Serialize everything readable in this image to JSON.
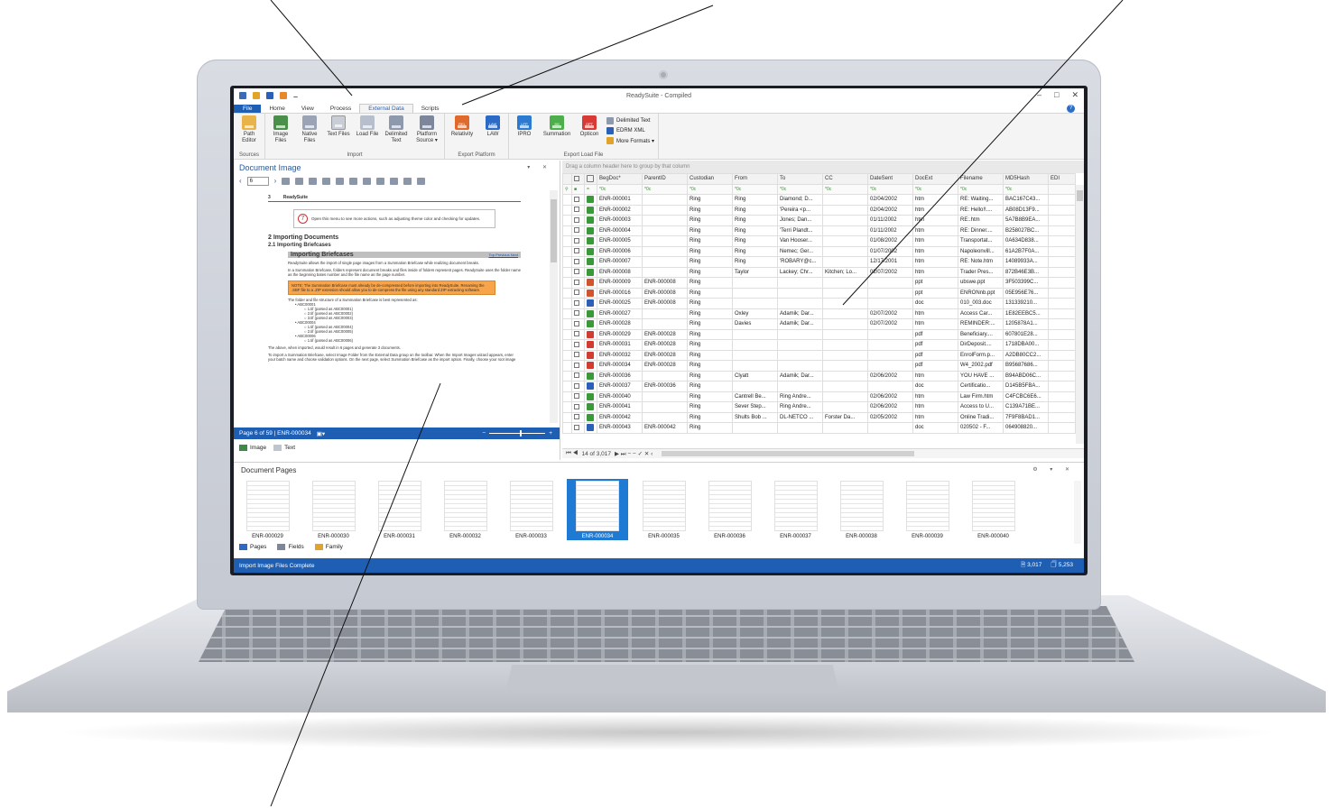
{
  "window": {
    "title": "ReadySuite - Compiled",
    "controls": [
      "–",
      "□",
      "✕"
    ]
  },
  "ribbon": {
    "tabs": [
      "File",
      "Home",
      "View",
      "Process",
      "External Data",
      "Scripts"
    ],
    "active_tab": "External Data",
    "help_glyph": "?",
    "groups": {
      "sources": {
        "label": "Sources",
        "buttons": [
          "Path Editor"
        ]
      },
      "import": {
        "label": "Import",
        "buttons": [
          "Image Files",
          "Native Files",
          "Text Files",
          "Load File",
          "Delimited Text",
          "Platform Source ▾"
        ]
      },
      "export_platform": {
        "label": "Export Platform",
        "buttons": [
          "Relativity",
          "LAW"
        ]
      },
      "export_load_file": {
        "label": "Export Load File",
        "buttons": [
          "IPRO",
          "Summation",
          "Opticon"
        ],
        "small": [
          "Delimited Text",
          "EDRM XML",
          "More Formats ▾"
        ]
      }
    },
    "icon_tags": [
      "REL",
      "LAW",
      "LFP",
      "DII",
      "OPT"
    ]
  },
  "doc_pane": {
    "title": "Document Image",
    "page_input": "6",
    "status_text": "Page 6 of 59  |  ENR-000034",
    "zoom_minus": "−",
    "zoom_plus": "+",
    "tabs": [
      "Image",
      "Text"
    ],
    "content": {
      "header_num": "3",
      "header_title": "ReadySuite",
      "note_num": "7",
      "note_text": "Open this menu to see more actions, such as adjusting theme color and checking for updates.",
      "section": "2     Importing Documents",
      "subsection": "2.1   Importing Briefcases",
      "banner": "Importing Briefcases",
      "banner_nav": "Top  Previous  Next",
      "p1": "ReadySuite allows the import of single page images from a Summation Briefcase while realizing document breaks.",
      "p2": "In a Summation Briefcase, folders represent document breaks and files inside of folders represent pages. ReadySuite uses the folder name as the beginning bates number and the file name as the page number.",
      "note_orange": "NOTE: The Summation Briefcase must already be de-compressed before importing into ReadySuite. Renaming the .SBF file to a .ZIP extension should allow you to de-compress the file using any standard ZIP extracting software.",
      "p3": "The folder and file structure of a Summation Briefcase is best represented as:",
      "tree": [
        "•  ABC00001",
        "○  1.tif  (parsed as ABC00001)",
        "○  2.tif  (parsed as ABC00002)",
        "○  3.tif  (parsed as ABC00003)",
        "•  ABC00004",
        "○  1.tif  (parsed as ABC00004)",
        "○  2.tif  (parsed as ABC00005)",
        "•  ABC00006",
        "○  1.tif  (parsed as ABC00006)"
      ],
      "p4": "The above, when imported, would result in 6 pages and generate 3 documents.",
      "p5": "To import a Summation Briefcase, select Image Folder from the External Data group on the toolbar. When the Import Images wizard appears, enter your batch name and choose validation options. On the next page, select Summation Briefcase as the import option. Finally, choose your root image"
    }
  },
  "grid": {
    "group_hint": "Drag a column header here to group by that column",
    "columns": [
      "BegDoc*",
      "ParentID",
      "Custodian",
      "From",
      "To",
      "CC",
      "DateSent",
      "DocExt",
      "Filename",
      "MD5Hash",
      "EDI"
    ],
    "filter_glyph": "*0c",
    "rows": [
      [
        "ENR-000001",
        "",
        "Ring",
        "Ring",
        "Diamond; D...",
        "",
        "02/04/2002",
        "htm",
        "RE: Waiting...",
        "BAC167C43..."
      ],
      [
        "ENR-000002",
        "",
        "Ring",
        "Ring",
        "'Pereira <p...",
        "",
        "02/04/2002",
        "htm",
        "RE: Hello!!....",
        "AB08D13F9..."
      ],
      [
        "ENR-000003",
        "",
        "Ring",
        "Ring",
        "Jones; Dan...",
        "",
        "01/11/2002",
        "htm",
        "RE:.htm",
        "5A7B8B9EA..."
      ],
      [
        "ENR-000004",
        "",
        "Ring",
        "Ring",
        "'Terri Plandt...",
        "",
        "01/11/2002",
        "htm",
        "RE: Dinner....",
        "B258027BC..."
      ],
      [
        "ENR-000005",
        "",
        "Ring",
        "Ring",
        "Van Hooser...",
        "",
        "01/08/2002",
        "htm",
        "Transportat...",
        "0A634D838..."
      ],
      [
        "ENR-000006",
        "",
        "Ring",
        "Ring",
        "Nemec; Ger...",
        "",
        "01/07/2002",
        "htm",
        "Napoleonvill...",
        "61A2B7F0A..."
      ],
      [
        "ENR-000007",
        "",
        "Ring",
        "Ring",
        "'ROBARY@c...",
        "",
        "12/17/2001",
        "htm",
        "RE: Note.htm",
        "14089933A..."
      ],
      [
        "ENR-000008",
        "",
        "Ring",
        "Taylor",
        "Lackey; Chr...",
        "Kitchen; Lo...",
        "02/07/2002",
        "htm",
        "Trader Pres...",
        "872B46E3B..."
      ],
      [
        "ENR-000009",
        "ENR-000008",
        "Ring",
        "",
        "",
        "",
        "",
        "ppt",
        "ubswe.ppt",
        "3F503399C..."
      ],
      [
        "ENR-000016",
        "ENR-000008",
        "Ring",
        "",
        "",
        "",
        "",
        "ppt",
        "ENRONnb.ppt",
        "05E956E76..."
      ],
      [
        "ENR-000025",
        "ENR-000008",
        "Ring",
        "",
        "",
        "",
        "",
        "doc",
        "010_003.doc",
        "131339210..."
      ],
      [
        "ENR-000027",
        "",
        "Ring",
        "Oxley",
        "Adamik; Dar...",
        "",
        "02/07/2002",
        "htm",
        "Access Car...",
        "1E82EEBC5..."
      ],
      [
        "ENR-000028",
        "",
        "Ring",
        "Davies",
        "Adamik; Dar...",
        "",
        "02/07/2002",
        "htm",
        "REMINDER:...",
        "1205878A1..."
      ],
      [
        "ENR-000029",
        "ENR-000028",
        "Ring",
        "",
        "",
        "",
        "",
        "pdf",
        "Beneficiary....",
        "607801E28..."
      ],
      [
        "ENR-000031",
        "ENR-000028",
        "Ring",
        "",
        "",
        "",
        "",
        "pdf",
        "DirDeposit....",
        "1718DBA00..."
      ],
      [
        "ENR-000032",
        "ENR-000028",
        "Ring",
        "",
        "",
        "",
        "",
        "pdf",
        "EnrolForm.p...",
        "A2DB80CC2..."
      ],
      [
        "ENR-000034",
        "ENR-000028",
        "Ring",
        "",
        "",
        "",
        "",
        "pdf",
        "W4_2002.pdf",
        "B95687686..."
      ],
      [
        "ENR-000036",
        "",
        "Ring",
        "Clyatt",
        "Adamik; Dar...",
        "",
        "02/06/2002",
        "htm",
        "YOU HAVE ...",
        "B94ABD06C..."
      ],
      [
        "ENR-000037",
        "ENR-000036",
        "Ring",
        "",
        "",
        "",
        "",
        "doc",
        "Certificatio...",
        "D145B5FBA..."
      ],
      [
        "ENR-000040",
        "",
        "Ring",
        "Cantrell Be...",
        "Ring Andre...",
        "",
        "02/06/2002",
        "htm",
        "Law Firm.htm",
        "C4FCBC6E6..."
      ],
      [
        "ENR-000041",
        "",
        "Ring",
        "Sever Step...",
        "Ring Andre...",
        "",
        "02/06/2002",
        "htm",
        "Access to U...",
        "C139A71BE..."
      ],
      [
        "ENR-000042",
        "",
        "Ring",
        "Shults Bob ...",
        "DL-NETCO ...",
        "Forster Da...",
        "02/05/2002",
        "htm",
        "Online Tradi...",
        "7F9F8BAD1..."
      ],
      [
        "ENR-000043",
        "ENR-000042",
        "Ring",
        "",
        "",
        "",
        "",
        "doc",
        "020502 - F...",
        "064908820..."
      ]
    ],
    "nav_text": "14 of 3,017",
    "nav_buttons": "⏮ ◀",
    "nav_buttons_right": "▶ ⏭ −  −  ✓  ✕  ‹"
  },
  "pages_pane": {
    "title": "Document Pages",
    "thumbs": [
      "ENR-000029",
      "ENR-000030",
      "ENR-000031",
      "ENR-000032",
      "ENR-000033",
      "ENR-000034",
      "ENR-000035",
      "ENR-000036",
      "ENR-000037",
      "ENR-000038",
      "ENR-000039",
      "ENR-000040"
    ],
    "selected": "ENR-000034",
    "tabs": [
      "Pages",
      "Fields",
      "Family"
    ]
  },
  "statusbar": {
    "text": "Import Image Files Complete",
    "doc_count": "3,017",
    "page_count": "5,253"
  },
  "colors": {
    "accent": "#1e5fb3",
    "selected_thumb": "#1f7ad3",
    "pdf": "#d23b2f",
    "htm": "#3a9a3a",
    "doc": "#2b5fb8",
    "ppt": "#d2542f"
  }
}
